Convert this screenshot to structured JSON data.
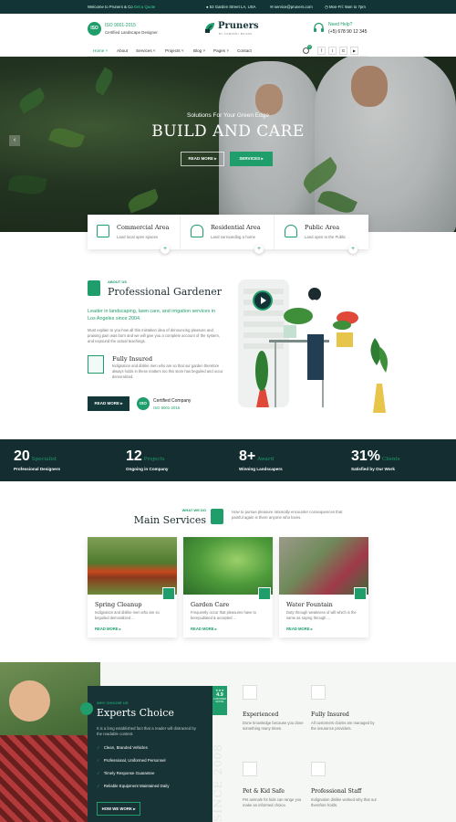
{
  "topbar": {
    "welcome": "Welcome to Pruners & Co",
    "quote_link": "Get a Quote",
    "address": "53 Garden Street LA, USA",
    "email": "service@pruners.com",
    "hours": "Mon-Fri: 9am to 7pm"
  },
  "header": {
    "iso_badge": "ISO",
    "iso_title": "ISO 9001-2015",
    "iso_sub": "Certified Landscape Designer",
    "logo": "Pruners",
    "logo_sub": "BY COMPANY BUILDS",
    "help_label": "Need Help?",
    "phone": "(+5) 678 90 12 345"
  },
  "nav": {
    "items": [
      "Home",
      "About",
      "Services",
      "Projects",
      "Blog",
      "Pages",
      "Contact"
    ],
    "cart_count": "0",
    "socials": [
      "f",
      "t",
      "G",
      "▶"
    ]
  },
  "hero": {
    "subtitle": "Solutions For Your Green Edge",
    "title": "BUILD AND CARE",
    "read_more": "READ MORE",
    "services": "SERVICES"
  },
  "features": [
    {
      "title": "Commercial Area",
      "desc": "Land local open spaces"
    },
    {
      "title": "Residential Area",
      "desc": "Land surrounding a home"
    },
    {
      "title": "Public Area",
      "desc": "Land open to the Public"
    }
  ],
  "about": {
    "eyebrow": "ABOUT US",
    "title": "Professional Gardener",
    "lead": "Leader in landscaping, lawn care, and irrigation services in Los Angeles since 2004.",
    "body": "Must explain to you how all this mistaken idea of denouncing pleasure and praising pain was born and we will give you a complete account of the system, and expound the actual teachings.",
    "insured_title": "Fully Insured",
    "insured_text": "Indignation and dislike men who are so that our garden therefore always holds in these matters too this store has beguiled and occur demoralized.",
    "read_more": "READ MORE",
    "cert_title": "Certified Company",
    "cert_sub": "ISO 9001-2015",
    "iso_badge": "ISO"
  },
  "stats": [
    {
      "num": "20",
      "word": "Specialist",
      "label": "Professional Designers"
    },
    {
      "num": "12",
      "word": "Projects",
      "label": "Ongoing in Company"
    },
    {
      "num": "8+",
      "word": "Award",
      "label": "Winning Landscapers"
    },
    {
      "num": "31%",
      "word": "Clients",
      "label": "Satisfied by Our Work"
    }
  ],
  "services_section": {
    "eyebrow": "WHAT WE DO",
    "title": "Main Services",
    "intro": "How to pursue pleasure rationally encounter consequences that painful again is there anyone who loves.",
    "items": [
      {
        "title": "Spring Cleanup",
        "desc": "Indignation and dislike men who are so beguiled demoralized ...",
        "more": "READ MORE"
      },
      {
        "title": "Garden Care",
        "desc": "Frequently occur that pleasures have to berepudiated & accepted ...",
        "more": "READ MORE"
      },
      {
        "title": "Water Fountain",
        "desc": "Duty through weakness of will which is the same as saying through ...",
        "more": "READ MORE"
      }
    ]
  },
  "experts": {
    "eyebrow": "WHY CHOOSE US",
    "title": "Experts Choice",
    "text": "It is a long established fact that a reader will distracted by the readable content.",
    "checklist": [
      "Clean, Branded Vehicles",
      "Professional, Uniformed Personnel",
      "Timely Response Guarantee",
      "Reliable Equipment Maintained Daily"
    ],
    "button": "HOW WE WORK",
    "rating": "4.9",
    "rating_label": "CUSTOMER RATING",
    "since": "SINCE 2008",
    "why": [
      {
        "title": "Experienced",
        "desc": "Done knowledge because you done something many times."
      },
      {
        "title": "Fully Insured",
        "desc": "All customers claims are managed by the insurance providers."
      },
      {
        "title": "Pet & Kid Safe",
        "desc": "Pet animals for kids can range you make an informed choice."
      },
      {
        "title": "Professional Staff",
        "desc": "Indignation dislike worked why that our therefore holds."
      }
    ]
  },
  "colors": {
    "accent": "#1f9d6b",
    "dark": "#14373a"
  }
}
